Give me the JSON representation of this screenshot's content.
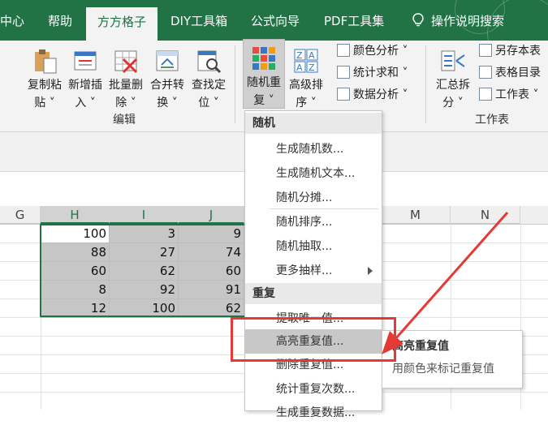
{
  "ribbon_tabs": {
    "center": "中心",
    "help": "帮助",
    "fangfang": "方方格子",
    "diy": "DIY工具箱",
    "formula": "公式向导",
    "pdf": "PDF工具集",
    "search": "操作说明搜索"
  },
  "ribbon": {
    "copy_paste": "复制粘\n贴 ˅",
    "insert_new": "新增插\n入 ˅",
    "batch_delete": "批量删\n除 ˅",
    "merge_convert": "合并转\n换 ˅",
    "find_locate": "查找定\n位 ˅",
    "random_repeat": "随机重\n复 ˅",
    "advanced_sort": "高级排\n序 ˅",
    "color_analysis": "颜色分析 ˅",
    "stat_sum": "统计求和 ˅",
    "data_analysis": "数据分析 ˅",
    "summary_split": "汇总拆\n分 ˅",
    "save_sheet": "另存本表",
    "sheet_directory": "表格目录",
    "worksheet": "工作表 ˅",
    "group_edit": "编辑",
    "group_worksheet": "工作表"
  },
  "columns": [
    "G",
    "H",
    "I",
    "J",
    "M",
    "N"
  ],
  "cells": {
    "H": [
      "100",
      "88",
      "60",
      "8",
      "12"
    ],
    "I": [
      "3",
      "27",
      "62",
      "92",
      "100"
    ],
    "J": [
      "9",
      "74",
      "60",
      "91",
      "62"
    ]
  },
  "menu": {
    "section_random": "随机",
    "gen_random_numbers": "生成随机数...",
    "gen_random_text": "生成随机文本...",
    "random_allocate": "随机分摊...",
    "random_sort": "随机排序...",
    "random_sample": "随机抽取...",
    "more_sampling": "更多抽样...",
    "section_repeat": "重复",
    "extract_unique": "提取唯一值...",
    "highlight_duplicates": "高亮重复值...",
    "delete_duplicates": "删除重复值...",
    "count_duplicates": "统计重复次数...",
    "gen_duplicate_data": "生成重复数据..."
  },
  "tooltip": {
    "title": "高亮重复值",
    "desc": "用颜色来标记重复值"
  },
  "colors": {
    "ribbon_green": "#217346",
    "annotation_red": "#e53935",
    "selection_gray": "#c6c6c6"
  }
}
